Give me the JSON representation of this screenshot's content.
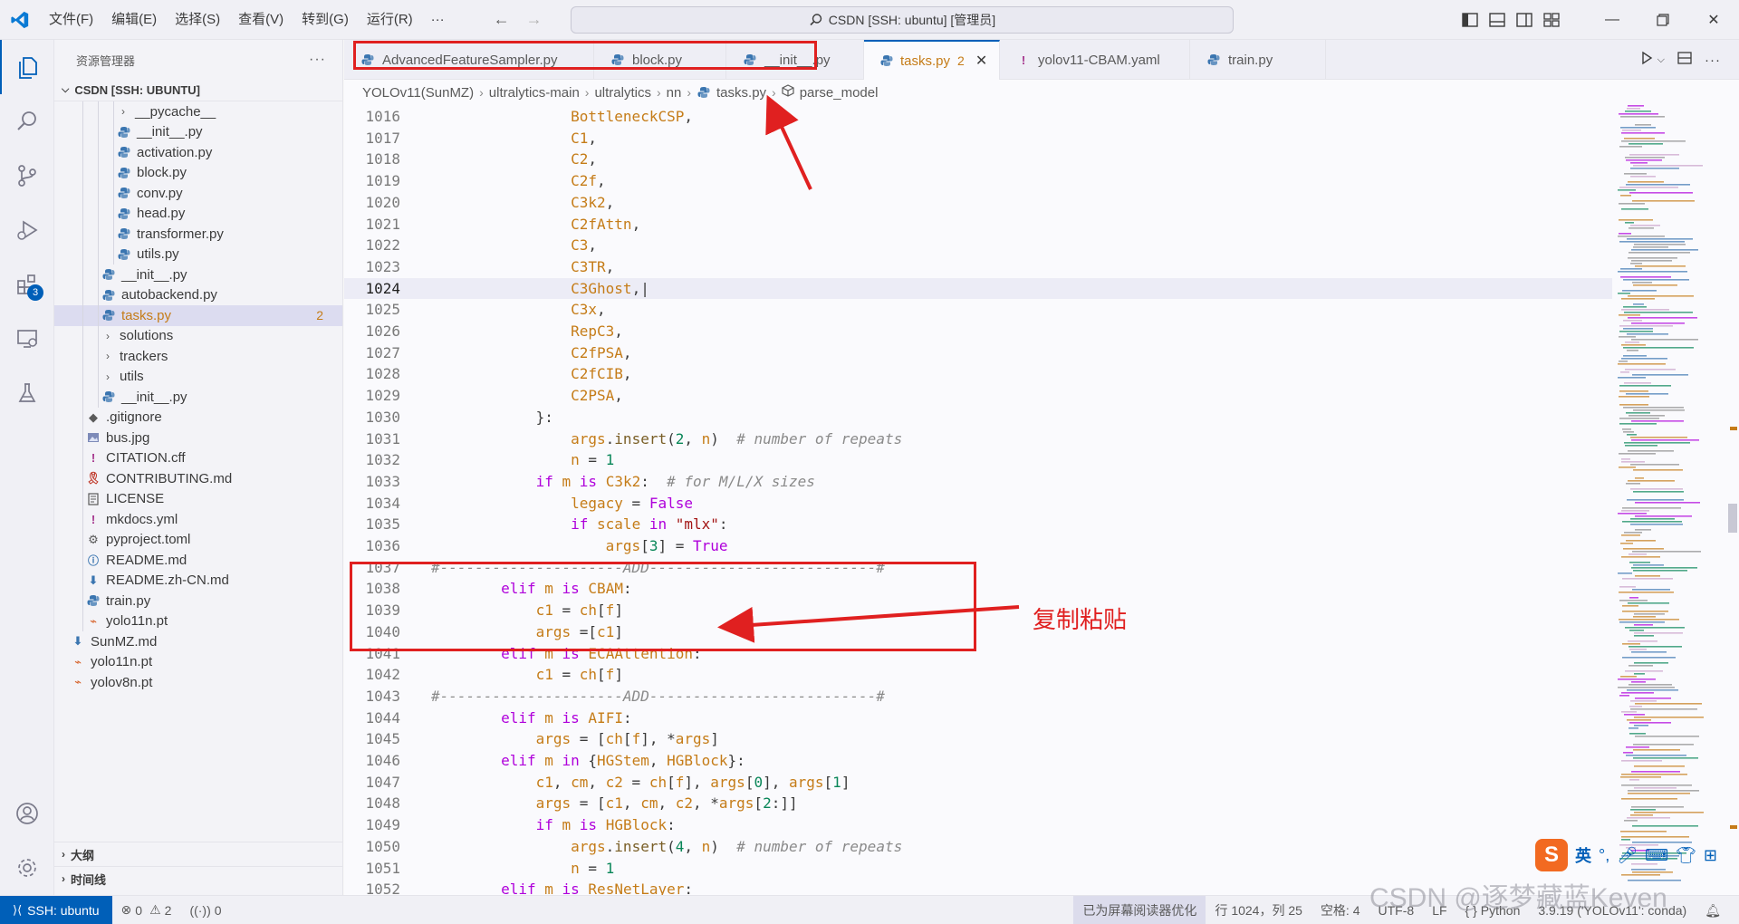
{
  "colors": {
    "accent": "#005fb8",
    "annotation": "#e02020",
    "modified": "#c57c18"
  },
  "titlebar": {
    "menus": [
      "文件(F)",
      "编辑(E)",
      "选择(S)",
      "查看(V)",
      "转到(G)",
      "运行(R)",
      "···"
    ],
    "command_center": "CSDN [SSH: ubuntu] [管理员]"
  },
  "activity": {
    "extensions_badge": "3"
  },
  "sidebar": {
    "title": "资源管理器",
    "more": "···",
    "workspace": "CSDN [SSH: UBUNTU]",
    "tree": [
      {
        "label": "__pycache__",
        "type": "folder",
        "depth": 3
      },
      {
        "label": "__init__.py",
        "type": "py",
        "depth": 3
      },
      {
        "label": "activation.py",
        "type": "py",
        "depth": 3
      },
      {
        "label": "block.py",
        "type": "py",
        "depth": 3
      },
      {
        "label": "conv.py",
        "type": "py",
        "depth": 3
      },
      {
        "label": "head.py",
        "type": "py",
        "depth": 3
      },
      {
        "label": "transformer.py",
        "type": "py",
        "depth": 3
      },
      {
        "label": "utils.py",
        "type": "py",
        "depth": 3
      },
      {
        "label": "__init__.py",
        "type": "py",
        "depth": 2
      },
      {
        "label": "autobackend.py",
        "type": "py",
        "depth": 2
      },
      {
        "label": "tasks.py",
        "type": "py",
        "depth": 2,
        "selected": true,
        "count": "2"
      },
      {
        "label": "solutions",
        "type": "folder",
        "depth": 2
      },
      {
        "label": "trackers",
        "type": "folder",
        "depth": 2
      },
      {
        "label": "utils",
        "type": "folder",
        "depth": 2
      },
      {
        "label": "__init__.py",
        "type": "py",
        "depth": 2
      },
      {
        "label": ".gitignore",
        "type": "git",
        "depth": 1
      },
      {
        "label": "bus.jpg",
        "type": "img",
        "depth": 1
      },
      {
        "label": "CITATION.cff",
        "type": "excl",
        "depth": 1
      },
      {
        "label": "CONTRIBUTING.md",
        "type": "ribbon",
        "depth": 1
      },
      {
        "label": "LICENSE",
        "type": "license",
        "depth": 1
      },
      {
        "label": "mkdocs.yml",
        "type": "excl",
        "depth": 1
      },
      {
        "label": "pyproject.toml",
        "type": "gear",
        "depth": 1
      },
      {
        "label": "README.md",
        "type": "info",
        "depth": 1
      },
      {
        "label": "README.zh-CN.md",
        "type": "down",
        "depth": 1
      },
      {
        "label": "train.py",
        "type": "py",
        "depth": 1
      },
      {
        "label": "yolo11n.pt",
        "type": "rss",
        "depth": 1
      },
      {
        "label": "SunMZ.md",
        "type": "down",
        "depth": 0
      },
      {
        "label": "yolo11n.pt",
        "type": "rss",
        "depth": 0
      },
      {
        "label": "yolov8n.pt",
        "type": "rss",
        "depth": 0
      }
    ],
    "outline": "大纲",
    "timeline": "时间线"
  },
  "tabs": [
    {
      "label": "AdvancedFeatureSampler.py",
      "icon": "py"
    },
    {
      "label": "block.py",
      "icon": "py"
    },
    {
      "label": "__init__.py",
      "icon": "py"
    },
    {
      "label": "tasks.py",
      "icon": "py",
      "active": true,
      "badge": "2"
    },
    {
      "label": "yolov11-CBAM.yaml",
      "icon": "excl"
    },
    {
      "label": "train.py",
      "icon": "py"
    }
  ],
  "breadcrumb": [
    "YOLOv11(SunMZ)",
    "ultralytics-main",
    "ultralytics",
    "nn",
    "tasks.py",
    "parse_model"
  ],
  "code": {
    "current_line": 1024,
    "lines": [
      {
        "n": 1016,
        "html": "                <span class='cls'>BottleneckCSP</span>,"
      },
      {
        "n": 1017,
        "html": "                <span class='cls'>C1</span>,"
      },
      {
        "n": 1018,
        "html": "                <span class='cls'>C2</span>,"
      },
      {
        "n": 1019,
        "html": "                <span class='cls'>C2f</span>,"
      },
      {
        "n": 1020,
        "html": "                <span class='cls'>C3k2</span>,"
      },
      {
        "n": 1021,
        "html": "                <span class='cls'>C2fAttn</span>,"
      },
      {
        "n": 1022,
        "html": "                <span class='cls'>C3</span>,"
      },
      {
        "n": 1023,
        "html": "                <span class='cls'>C3TR</span>,"
      },
      {
        "n": 1024,
        "html": "                <span class='cls'>C3Ghost</span>,|"
      },
      {
        "n": 1025,
        "html": "                <span class='cls'>C3x</span>,"
      },
      {
        "n": 1026,
        "html": "                <span class='cls'>RepC3</span>,"
      },
      {
        "n": 1027,
        "html": "                <span class='cls'>C2fPSA</span>,"
      },
      {
        "n": 1028,
        "html": "                <span class='cls'>C2fCIB</span>,"
      },
      {
        "n": 1029,
        "html": "                <span class='cls'>C2PSA</span>,"
      },
      {
        "n": 1030,
        "html": "            }:"
      },
      {
        "n": 1031,
        "html": "                <span class='var'>args</span>.<span class='fn'>insert</span>(<span class='num'>2</span>, <span class='var'>n</span>)  <span class='cmt'># number of repeats</span>"
      },
      {
        "n": 1032,
        "html": "                <span class='var'>n</span> = <span class='num'>1</span>"
      },
      {
        "n": 1033,
        "html": "            <span class='kw'>if</span> <span class='var'>m</span> <span class='kw'>is</span> <span class='cls'>C3k2</span>:  <span class='cmt'># for M/L/X sizes</span>"
      },
      {
        "n": 1034,
        "html": "                <span class='var'>legacy</span> = <span class='kw'>False</span>"
      },
      {
        "n": 1035,
        "html": "                <span class='kw'>if</span> <span class='var'>scale</span> <span class='kw'>in</span> <span class='str'>\"mlx\"</span>:"
      },
      {
        "n": 1036,
        "html": "                    <span class='var'>args</span>[<span class='num'>3</span>] = <span class='kw'>True</span>"
      },
      {
        "n": 1037,
        "html": "<span class='cmt'>#---------------------ADD--------------------------#</span>"
      },
      {
        "n": 1038,
        "html": "        <span class='kw'>elif</span> <span class='var'>m</span> <span class='kw'>is</span> <span class='cls'>CBAM</span>:"
      },
      {
        "n": 1039,
        "html": "            <span class='var'>c1</span> = <span class='var'>ch</span>[<span class='var'>f</span>]"
      },
      {
        "n": 1040,
        "html": "            <span class='var'>args</span> =[<span class='var'>c1</span>]"
      },
      {
        "n": 1041,
        "html": "        <span class='kw'>elif</span> <span class='var'>m</span> <span class='kw'>is</span> <span class='cls'>ECAAttention</span>:"
      },
      {
        "n": 1042,
        "html": "            <span class='var'>c1</span> = <span class='var'>ch</span>[<span class='var'>f</span>]"
      },
      {
        "n": 1043,
        "html": "<span class='cmt'>#---------------------ADD--------------------------#</span>"
      },
      {
        "n": 1044,
        "html": "        <span class='kw'>elif</span> <span class='var'>m</span> <span class='kw'>is</span> <span class='cls'>AIFI</span>:"
      },
      {
        "n": 1045,
        "html": "            <span class='var'>args</span> = [<span class='var'>ch</span>[<span class='var'>f</span>], *<span class='var'>args</span>]"
      },
      {
        "n": 1046,
        "html": "        <span class='kw'>elif</span> <span class='var'>m</span> <span class='kw'>in</span> {<span class='cls'>HGStem</span>, <span class='cls'>HGBlock</span>}:"
      },
      {
        "n": 1047,
        "html": "            <span class='var'>c1</span>, <span class='var'>cm</span>, <span class='var'>c2</span> = <span class='var'>ch</span>[<span class='var'>f</span>], <span class='var'>args</span>[<span class='num'>0</span>], <span class='var'>args</span>[<span class='num'>1</span>]"
      },
      {
        "n": 1048,
        "html": "            <span class='var'>args</span> = [<span class='var'>c1</span>, <span class='var'>cm</span>, <span class='var'>c2</span>, *<span class='var'>args</span>[<span class='num'>2</span>:]]"
      },
      {
        "n": 1049,
        "html": "            <span class='kw'>if</span> <span class='var'>m</span> <span class='kw'>is</span> <span class='cls'>HGBlock</span>:"
      },
      {
        "n": 1050,
        "html": "                <span class='var'>args</span>.<span class='fn'>insert</span>(<span class='num'>4</span>, <span class='var'>n</span>)  <span class='cmt'># number of repeats</span>"
      },
      {
        "n": 1051,
        "html": "                <span class='var'>n</span> = <span class='num'>1</span>"
      },
      {
        "n": 1052,
        "html": "        <span class='kw'>elif</span> <span class='var'>m</span> <span class='kw'>is</span> <span class='cls'>ResNetLayer</span>:"
      }
    ]
  },
  "annotation": {
    "text": "复制粘贴"
  },
  "statusbar": {
    "remote": "SSH: ubuntu",
    "errors": "0",
    "warnings": "2",
    "ports": "0",
    "screen_reader": "已为屏幕阅读器优化",
    "position": "行 1024，列 25",
    "spaces": "空格: 4",
    "encoding": "UTF-8",
    "eol": "LF",
    "language": "Python",
    "interpreter": "3.9.19 ('YOLOv11': conda)"
  },
  "ime": {
    "mode": "英"
  },
  "watermark": "CSDN @逐梦藏蓝Keven"
}
